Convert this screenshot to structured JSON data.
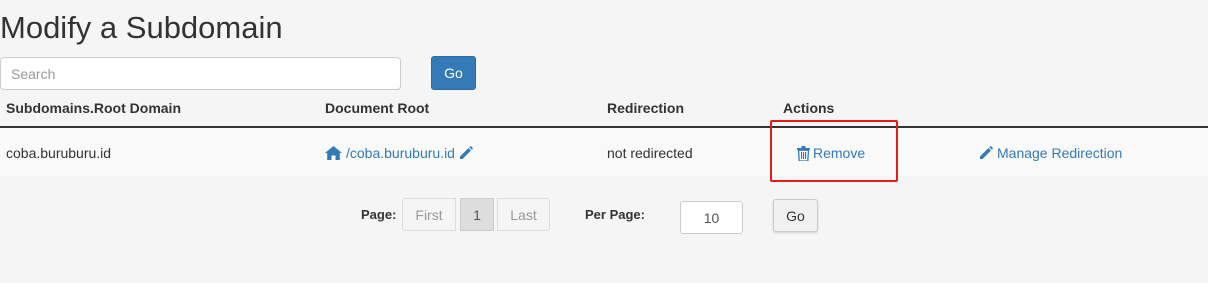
{
  "page": {
    "title": "Modify a Subdomain"
  },
  "search": {
    "placeholder": "Search",
    "go_label": "Go"
  },
  "table": {
    "headers": {
      "subdomain": "Subdomains.Root Domain",
      "document_root": "Document Root",
      "redirection": "Redirection",
      "actions": "Actions"
    },
    "rows": [
      {
        "subdomain": "coba.buruburu.id",
        "document_root": "/coba.buruburu.id",
        "redirection": "not redirected",
        "remove_label": "Remove",
        "manage_redirection_label": "Manage Redirection"
      }
    ]
  },
  "pagination": {
    "page_label": "Page:",
    "first_label": "First",
    "current_page": "1",
    "last_label": "Last",
    "per_page_label": "Per Page:",
    "per_page_value": "10",
    "go_label": "Go"
  },
  "icons": {
    "home": "home-icon",
    "edit": "pencil-icon",
    "trash": "trash-icon"
  },
  "colors": {
    "primary": "#337ab7",
    "link": "#337ab7",
    "highlight": "#e31b1b"
  }
}
